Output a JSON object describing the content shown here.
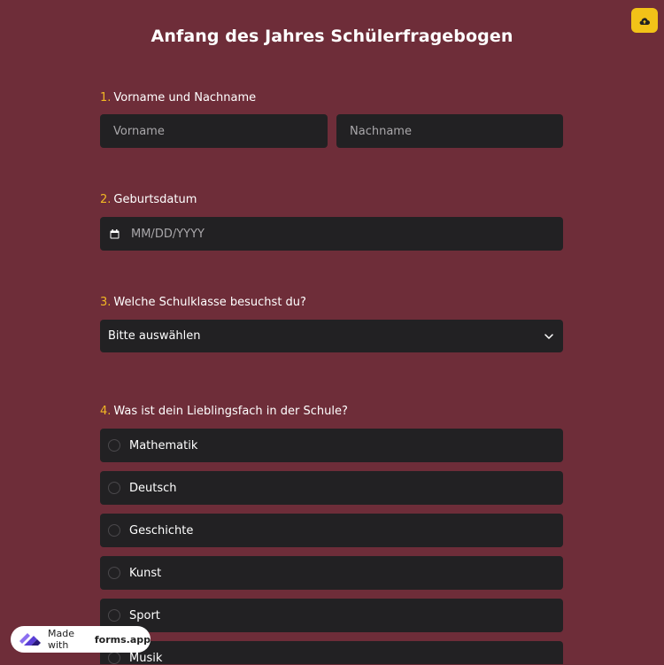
{
  "title": "Anfang des Jahres Schülerfragebogen",
  "questions": [
    {
      "number": "1.",
      "label": "Vorname und Nachname",
      "first_placeholder": "Vorname",
      "last_placeholder": "Nachname"
    },
    {
      "number": "2.",
      "label": "Geburtsdatum",
      "placeholder": "MM/DD/YYYY"
    },
    {
      "number": "3.",
      "label": "Welche Schulklasse besuchst du?",
      "selected": "Bitte auswählen"
    },
    {
      "number": "4.",
      "label": "Was ist dein Lieblingsfach in der Schule?",
      "options": [
        "Mathematik",
        "Deutsch",
        "Geschichte",
        "Kunst",
        "Sport",
        "Musik"
      ]
    }
  ],
  "badge": {
    "prefix": "Made with",
    "brand": "forms.app"
  },
  "icons": {
    "save": "cloud-upload-icon",
    "calendar": "calendar-icon",
    "dropdown": "chevron-down-icon",
    "logo": "forms-app-logo-icon"
  },
  "colors": {
    "background": "#6e2d39",
    "field": "#222123",
    "accent": "#f2b824",
    "save_button": "#f2c218"
  }
}
